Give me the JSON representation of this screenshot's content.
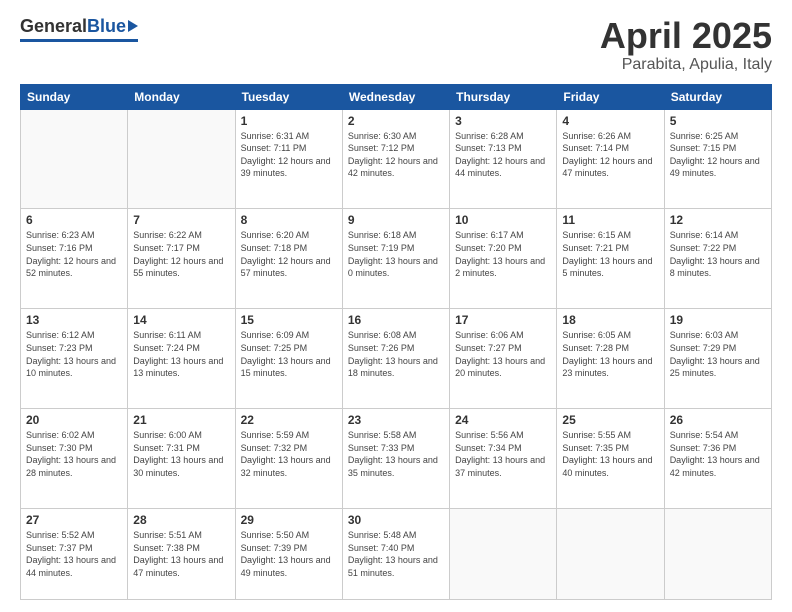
{
  "logo": {
    "general": "General",
    "blue": "Blue"
  },
  "title": "April 2025",
  "location": "Parabita, Apulia, Italy",
  "headers": [
    "Sunday",
    "Monday",
    "Tuesday",
    "Wednesday",
    "Thursday",
    "Friday",
    "Saturday"
  ],
  "weeks": [
    [
      {
        "day": "",
        "info": ""
      },
      {
        "day": "",
        "info": ""
      },
      {
        "day": "1",
        "sunrise": "Sunrise: 6:31 AM",
        "sunset": "Sunset: 7:11 PM",
        "daylight": "Daylight: 12 hours and 39 minutes."
      },
      {
        "day": "2",
        "sunrise": "Sunrise: 6:30 AM",
        "sunset": "Sunset: 7:12 PM",
        "daylight": "Daylight: 12 hours and 42 minutes."
      },
      {
        "day": "3",
        "sunrise": "Sunrise: 6:28 AM",
        "sunset": "Sunset: 7:13 PM",
        "daylight": "Daylight: 12 hours and 44 minutes."
      },
      {
        "day": "4",
        "sunrise": "Sunrise: 6:26 AM",
        "sunset": "Sunset: 7:14 PM",
        "daylight": "Daylight: 12 hours and 47 minutes."
      },
      {
        "day": "5",
        "sunrise": "Sunrise: 6:25 AM",
        "sunset": "Sunset: 7:15 PM",
        "daylight": "Daylight: 12 hours and 49 minutes."
      }
    ],
    [
      {
        "day": "6",
        "sunrise": "Sunrise: 6:23 AM",
        "sunset": "Sunset: 7:16 PM",
        "daylight": "Daylight: 12 hours and 52 minutes."
      },
      {
        "day": "7",
        "sunrise": "Sunrise: 6:22 AM",
        "sunset": "Sunset: 7:17 PM",
        "daylight": "Daylight: 12 hours and 55 minutes."
      },
      {
        "day": "8",
        "sunrise": "Sunrise: 6:20 AM",
        "sunset": "Sunset: 7:18 PM",
        "daylight": "Daylight: 12 hours and 57 minutes."
      },
      {
        "day": "9",
        "sunrise": "Sunrise: 6:18 AM",
        "sunset": "Sunset: 7:19 PM",
        "daylight": "Daylight: 13 hours and 0 minutes."
      },
      {
        "day": "10",
        "sunrise": "Sunrise: 6:17 AM",
        "sunset": "Sunset: 7:20 PM",
        "daylight": "Daylight: 13 hours and 2 minutes."
      },
      {
        "day": "11",
        "sunrise": "Sunrise: 6:15 AM",
        "sunset": "Sunset: 7:21 PM",
        "daylight": "Daylight: 13 hours and 5 minutes."
      },
      {
        "day": "12",
        "sunrise": "Sunrise: 6:14 AM",
        "sunset": "Sunset: 7:22 PM",
        "daylight": "Daylight: 13 hours and 8 minutes."
      }
    ],
    [
      {
        "day": "13",
        "sunrise": "Sunrise: 6:12 AM",
        "sunset": "Sunset: 7:23 PM",
        "daylight": "Daylight: 13 hours and 10 minutes."
      },
      {
        "day": "14",
        "sunrise": "Sunrise: 6:11 AM",
        "sunset": "Sunset: 7:24 PM",
        "daylight": "Daylight: 13 hours and 13 minutes."
      },
      {
        "day": "15",
        "sunrise": "Sunrise: 6:09 AM",
        "sunset": "Sunset: 7:25 PM",
        "daylight": "Daylight: 13 hours and 15 minutes."
      },
      {
        "day": "16",
        "sunrise": "Sunrise: 6:08 AM",
        "sunset": "Sunset: 7:26 PM",
        "daylight": "Daylight: 13 hours and 18 minutes."
      },
      {
        "day": "17",
        "sunrise": "Sunrise: 6:06 AM",
        "sunset": "Sunset: 7:27 PM",
        "daylight": "Daylight: 13 hours and 20 minutes."
      },
      {
        "day": "18",
        "sunrise": "Sunrise: 6:05 AM",
        "sunset": "Sunset: 7:28 PM",
        "daylight": "Daylight: 13 hours and 23 minutes."
      },
      {
        "day": "19",
        "sunrise": "Sunrise: 6:03 AM",
        "sunset": "Sunset: 7:29 PM",
        "daylight": "Daylight: 13 hours and 25 minutes."
      }
    ],
    [
      {
        "day": "20",
        "sunrise": "Sunrise: 6:02 AM",
        "sunset": "Sunset: 7:30 PM",
        "daylight": "Daylight: 13 hours and 28 minutes."
      },
      {
        "day": "21",
        "sunrise": "Sunrise: 6:00 AM",
        "sunset": "Sunset: 7:31 PM",
        "daylight": "Daylight: 13 hours and 30 minutes."
      },
      {
        "day": "22",
        "sunrise": "Sunrise: 5:59 AM",
        "sunset": "Sunset: 7:32 PM",
        "daylight": "Daylight: 13 hours and 32 minutes."
      },
      {
        "day": "23",
        "sunrise": "Sunrise: 5:58 AM",
        "sunset": "Sunset: 7:33 PM",
        "daylight": "Daylight: 13 hours and 35 minutes."
      },
      {
        "day": "24",
        "sunrise": "Sunrise: 5:56 AM",
        "sunset": "Sunset: 7:34 PM",
        "daylight": "Daylight: 13 hours and 37 minutes."
      },
      {
        "day": "25",
        "sunrise": "Sunrise: 5:55 AM",
        "sunset": "Sunset: 7:35 PM",
        "daylight": "Daylight: 13 hours and 40 minutes."
      },
      {
        "day": "26",
        "sunrise": "Sunrise: 5:54 AM",
        "sunset": "Sunset: 7:36 PM",
        "daylight": "Daylight: 13 hours and 42 minutes."
      }
    ],
    [
      {
        "day": "27",
        "sunrise": "Sunrise: 5:52 AM",
        "sunset": "Sunset: 7:37 PM",
        "daylight": "Daylight: 13 hours and 44 minutes."
      },
      {
        "day": "28",
        "sunrise": "Sunrise: 5:51 AM",
        "sunset": "Sunset: 7:38 PM",
        "daylight": "Daylight: 13 hours and 47 minutes."
      },
      {
        "day": "29",
        "sunrise": "Sunrise: 5:50 AM",
        "sunset": "Sunset: 7:39 PM",
        "daylight": "Daylight: 13 hours and 49 minutes."
      },
      {
        "day": "30",
        "sunrise": "Sunrise: 5:48 AM",
        "sunset": "Sunset: 7:40 PM",
        "daylight": "Daylight: 13 hours and 51 minutes."
      },
      {
        "day": "",
        "info": ""
      },
      {
        "day": "",
        "info": ""
      },
      {
        "day": "",
        "info": ""
      }
    ]
  ]
}
